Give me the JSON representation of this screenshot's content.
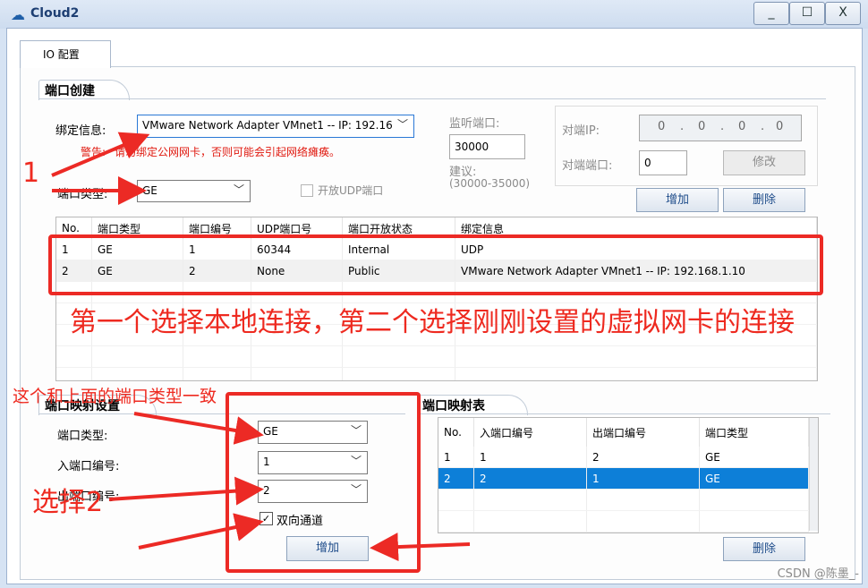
{
  "window": {
    "title": "Cloud2",
    "minimize": "_",
    "maximize": "☐",
    "close": "X"
  },
  "tab": "IO 配置",
  "port_create": {
    "group_title": "端口创建",
    "bind_label": "绑定信息:",
    "bind_value": "VMware Network Adapter VMnet1 -- IP: 192.16",
    "warning_prefix": "警告:",
    "warning": "请勿绑定公网网卡，否则可能会引起网络瘫痪。",
    "port_type_label": "端口类型:",
    "port_type_value": "GE",
    "udp_checkbox_label": "开放UDP端口",
    "listen_label": "监听端口:",
    "listen_value": "30000",
    "suggest_label": "建议:",
    "suggest_range": "(30000-35000)",
    "peer_ip_label": "对端IP:",
    "peer_ip_octets": [
      "0",
      "0",
      "0",
      "0"
    ],
    "peer_port_label": "对端端口:",
    "peer_port_value": "0",
    "modify_button": "修改",
    "add_button": "增加",
    "delete_button": "删除",
    "table": {
      "headers": [
        "No.",
        "端口类型",
        "端口编号",
        "UDP端口号",
        "端口开放状态",
        "绑定信息"
      ],
      "rows": [
        [
          "1",
          "GE",
          "1",
          "60344",
          "Internal",
          "UDP"
        ],
        [
          "2",
          "GE",
          "2",
          "None",
          "Public",
          "VMware Network Adapter VMnet1 -- IP: 192.168.1.10"
        ]
      ]
    }
  },
  "port_map_set": {
    "group_title": "端口映射设置",
    "port_type_label": "端口类型:",
    "port_type_value": "GE",
    "in_port_label": "入端口编号:",
    "in_port_value": "1",
    "out_port_label": "出端口编号:",
    "out_port_value": "2",
    "bidirectional_label": "双向通道",
    "bidirectional_checked": true,
    "add_button": "增加"
  },
  "port_map_table": {
    "group_title": "端口映射表",
    "headers": [
      "No.",
      "入端口编号",
      "出端口编号",
      "端口类型"
    ],
    "rows": [
      [
        "1",
        "1",
        "2",
        "GE"
      ],
      [
        "2",
        "2",
        "1",
        "GE"
      ]
    ],
    "selected_row": 1,
    "delete_button": "删除"
  },
  "annotations": {
    "step_one": "1",
    "select_hint": "第一个选择本地连接，第二个选择刚刚设置的虚拟网卡的连接",
    "consistent_hint": "这个和上面的端口类型一致",
    "select_two": "选择2"
  },
  "watermark": "CSDN @陈墨_-",
  "colors": {
    "accent": "#0d7fd8",
    "annotation": "#ec2a25",
    "warning": "#e0190f"
  }
}
